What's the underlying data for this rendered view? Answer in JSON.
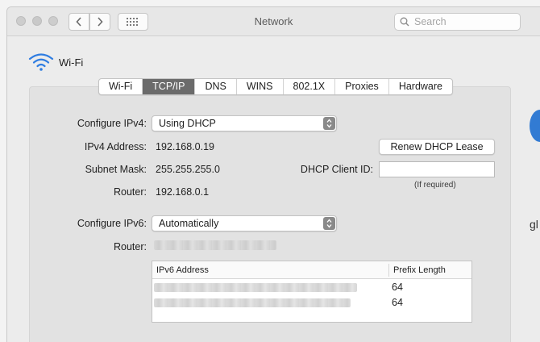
{
  "window": {
    "title": "Network"
  },
  "search": {
    "placeholder": "Search"
  },
  "service": {
    "name": "Wi-Fi"
  },
  "tabs": [
    {
      "label": "Wi-Fi",
      "active": false
    },
    {
      "label": "TCP/IP",
      "active": true
    },
    {
      "label": "DNS",
      "active": false
    },
    {
      "label": "WINS",
      "active": false
    },
    {
      "label": "802.1X",
      "active": false
    },
    {
      "label": "Proxies",
      "active": false
    },
    {
      "label": "Hardware",
      "active": false
    }
  ],
  "ipv4": {
    "configure_label": "Configure IPv4:",
    "configure_value": "Using DHCP",
    "address_label": "IPv4 Address:",
    "address_value": "192.168.0.19",
    "subnet_label": "Subnet Mask:",
    "subnet_value": "255.255.255.0",
    "router_label": "Router:",
    "router_value": "192.168.0.1",
    "renew_button": "Renew DHCP Lease",
    "client_id_label": "DHCP Client ID:",
    "client_id_value": "",
    "client_id_hint": "(If required)"
  },
  "ipv6": {
    "configure_label": "Configure IPv6:",
    "configure_value": "Automatically",
    "router_label": "Router:",
    "table": {
      "col_address": "IPv6 Address",
      "col_prefix": "Prefix Length",
      "rows": [
        {
          "prefix": "64"
        },
        {
          "prefix": "64"
        }
      ]
    }
  },
  "edge": {
    "partial_text": "gl"
  },
  "colors": {
    "active_tab": "#6b6b6b",
    "panel": "#e2e2e2",
    "window": "#ececec"
  }
}
